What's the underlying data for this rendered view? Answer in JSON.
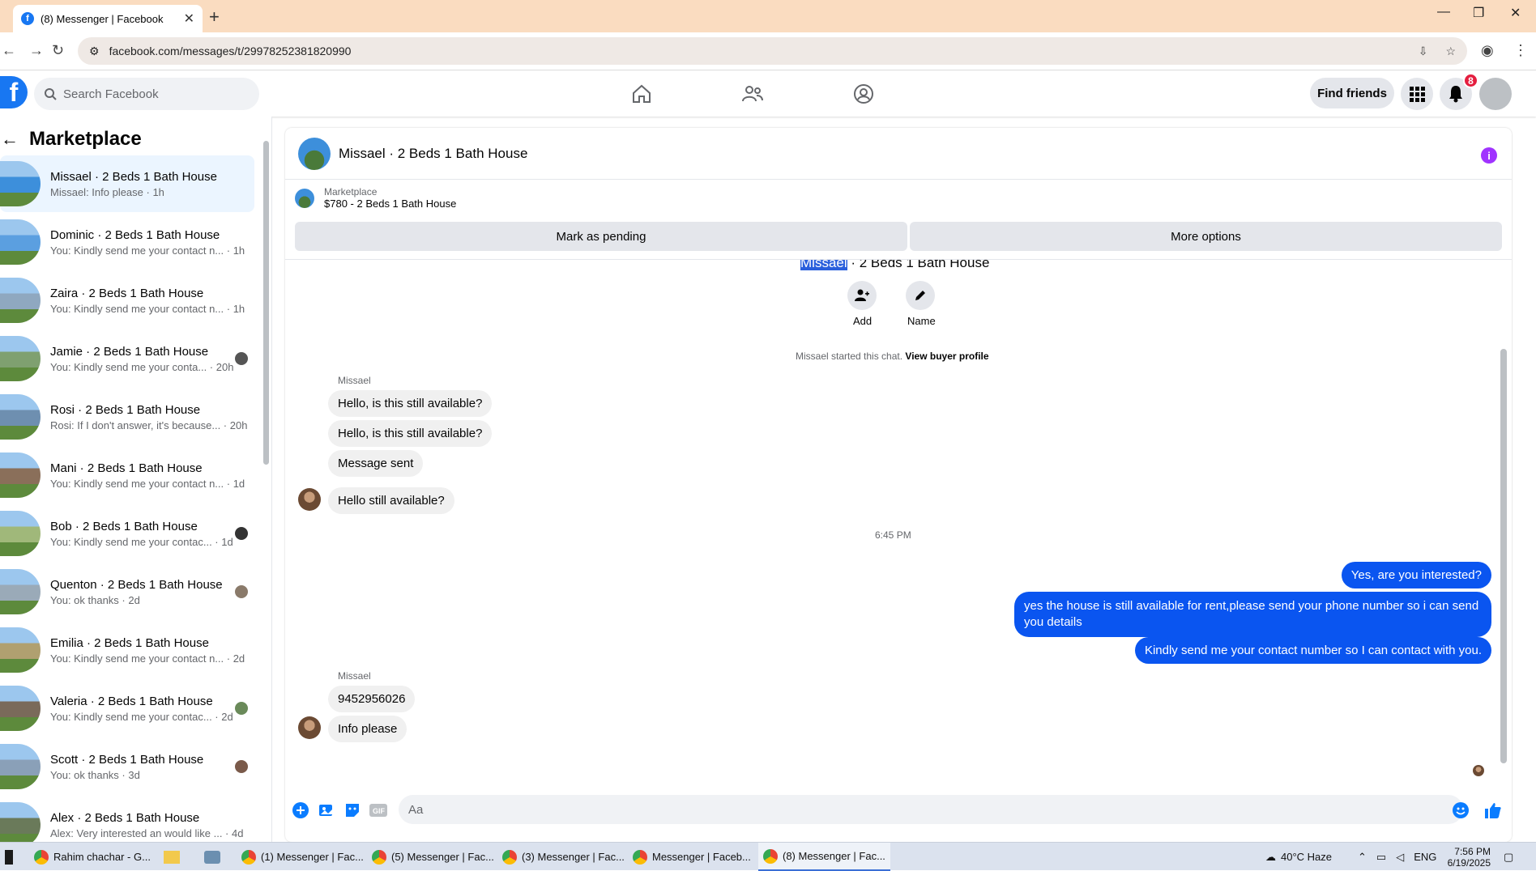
{
  "browser": {
    "tab_title": "(8) Messenger | Facebook",
    "new_tab": "+",
    "url": "facebook.com/messages/t/29978252381820990"
  },
  "fb": {
    "logo": "f",
    "search_placeholder": "Search Facebook",
    "find_friends": "Find friends",
    "notif_count": "8"
  },
  "sidebar": {
    "title": "Marketplace",
    "conversations": [
      {
        "name": "Missael · 2 Beds 1 Bath House",
        "preview": "Missael: Info please · 1h",
        "color": "#3d8fdb"
      },
      {
        "name": "Dominic · 2 Beds 1 Bath House",
        "preview": "You: Kindly send me your contact n... · 1h",
        "color": "#5b9fe0"
      },
      {
        "name": "Zaira · 2 Beds 1 Bath House",
        "preview": "You: Kindly send me your contact n... · 1h",
        "color": "#8fa8c0"
      },
      {
        "name": "Jamie · 2 Beds 1 Bath House",
        "preview": "You: Kindly send me your conta... · 20h",
        "color": "#7fa070"
      },
      {
        "name": "Rosi · 2 Beds 1 Bath House",
        "preview": "Rosi: If I don't answer, it's because... · 20h",
        "color": "#6e8fb0"
      },
      {
        "name": "Mani · 2 Beds 1 Bath House",
        "preview": "You: Kindly send me your contact n... · 1d",
        "color": "#8a6f5a"
      },
      {
        "name": "Bob · 2 Beds 1 Bath House",
        "preview": "You: Kindly send me your contac... · 1d",
        "color": "#a0b87a"
      },
      {
        "name": "Quenton · 2 Beds 1 Bath House",
        "preview": "You: ok thanks · 2d",
        "color": "#9aaab8"
      },
      {
        "name": "Emilia · 2 Beds 1 Bath House",
        "preview": "You: Kindly send me your contact n... · 2d",
        "color": "#b0a070"
      },
      {
        "name": "Valeria · 2 Beds 1 Bath House",
        "preview": "You: Kindly send me your contac... · 2d",
        "color": "#7a6a5a"
      },
      {
        "name": "Scott · 2 Beds 1 Bath House",
        "preview": "You: ok thanks · 3d",
        "color": "#8aa0b8"
      },
      {
        "name": "Alex · 2 Beds 1 Bath House",
        "preview": "Alex: Very interested an would like ... · 4d",
        "color": "#6a7a5a"
      }
    ]
  },
  "chat": {
    "title": "Missael · 2 Beds 1 Bath House",
    "listing_source": "Marketplace",
    "listing_title": "$780 - 2 Beds 1 Bath House",
    "mark_pending": "Mark as pending",
    "more_options": "More options",
    "top_title_highlight": "Missael",
    "top_title_rest": " · 2 Beds 1 Bath House",
    "add_label": "Add",
    "name_label": "Name",
    "started_text": "Missael started this chat.",
    "view_buyer": "View buyer profile",
    "sender_name": "Missael",
    "msgs_in_1": [
      "Hello, is this still available?",
      "Hello, is this still available?",
      "Message sent",
      "Hello still available?"
    ],
    "timestamp": "6:45 PM",
    "msgs_out": [
      "Yes, are you interested?",
      "yes the house is still available for rent,please send your  phone number so i can send",
      "you details",
      "Kindly send me your contact number so I can contact with you."
    ],
    "msgs_in_2": [
      "9452956026",
      "Info please"
    ],
    "composer_placeholder": "Aa"
  },
  "taskbar": {
    "items": [
      "Rahim chachar - G...",
      "(1) Messenger | Fac...",
      "(5) Messenger | Fac...",
      "(3) Messenger | Fac...",
      "Messenger | Faceb...",
      "(8) Messenger | Fac..."
    ],
    "weather": "40°C  Haze",
    "lang": "ENG",
    "time": "7:56 PM",
    "date": "6/19/2025"
  }
}
